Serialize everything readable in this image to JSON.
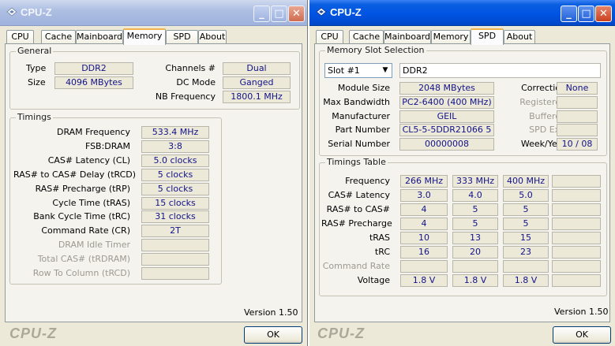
{
  "win1": {
    "title": "CPU-Z",
    "tabs": [
      "CPU",
      "Cache",
      "Mainboard",
      "Memory",
      "SPD",
      "About"
    ],
    "active_tab": "Memory",
    "general": {
      "title": "General",
      "type_label": "Type",
      "type_value": "DDR2",
      "size_label": "Size",
      "size_value": "4096 MBytes",
      "channels_label": "Channels #",
      "channels_value": "Dual",
      "dcmode_label": "DC Mode",
      "dcmode_value": "Ganged",
      "nbfreq_label": "NB Frequency",
      "nbfreq_value": "1800.1 MHz"
    },
    "timings": {
      "title": "Timings",
      "rows": [
        {
          "label": "DRAM Frequency",
          "value": "533.4 MHz",
          "disabled": false
        },
        {
          "label": "FSB:DRAM",
          "value": "3:8",
          "disabled": false
        },
        {
          "label": "CAS# Latency (CL)",
          "value": "5.0 clocks",
          "disabled": false
        },
        {
          "label": "RAS# to CAS# Delay (tRCD)",
          "value": "5 clocks",
          "disabled": false
        },
        {
          "label": "RAS# Precharge (tRP)",
          "value": "5 clocks",
          "disabled": false
        },
        {
          "label": "Cycle Time (tRAS)",
          "value": "15 clocks",
          "disabled": false
        },
        {
          "label": "Bank Cycle Time (tRC)",
          "value": "31 clocks",
          "disabled": false
        },
        {
          "label": "Command Rate (CR)",
          "value": "2T",
          "disabled": false
        },
        {
          "label": "DRAM Idle Timer",
          "value": "",
          "disabled": true
        },
        {
          "label": "Total CAS# (tRDRAM)",
          "value": "",
          "disabled": true
        },
        {
          "label": "Row To Column (tRCD)",
          "value": "",
          "disabled": true
        }
      ]
    },
    "version": "Version 1.50",
    "brand": "CPU-Z",
    "ok": "OK"
  },
  "win2": {
    "title": "CPU-Z",
    "tabs": [
      "CPU",
      "Cache",
      "Mainboard",
      "Memory",
      "SPD",
      "About"
    ],
    "active_tab": "SPD",
    "slot": {
      "title": "Memory Slot Selection",
      "selected": "Slot #1",
      "type": "DDR2",
      "rows_left": [
        {
          "label": "Module Size",
          "value": "2048 MBytes"
        },
        {
          "label": "Max Bandwidth",
          "value": "PC2-6400 (400 MHz)"
        },
        {
          "label": "Manufacturer",
          "value": "GEIL"
        },
        {
          "label": "Part Number",
          "value": "CL5-5-5DDR21066 5"
        },
        {
          "label": "Serial Number",
          "value": "00000008"
        }
      ],
      "rows_right": [
        {
          "label": "Correction",
          "value": "None",
          "disabled": false
        },
        {
          "label": "Registered",
          "value": "",
          "disabled": true
        },
        {
          "label": "Buffered",
          "value": "",
          "disabled": true
        },
        {
          "label": "SPD Ext.",
          "value": "",
          "disabled": true
        },
        {
          "label": "Week/Year",
          "value": "10 / 08",
          "disabled": false
        }
      ]
    },
    "table": {
      "title": "Timings Table",
      "rows": [
        {
          "label": "Frequency",
          "values": [
            "266 MHz",
            "333 MHz",
            "400 MHz",
            ""
          ],
          "disabled": false
        },
        {
          "label": "CAS# Latency",
          "values": [
            "3.0",
            "4.0",
            "5.0",
            ""
          ],
          "disabled": false
        },
        {
          "label": "RAS# to CAS#",
          "values": [
            "4",
            "5",
            "5",
            ""
          ],
          "disabled": false
        },
        {
          "label": "RAS# Precharge",
          "values": [
            "4",
            "5",
            "5",
            ""
          ],
          "disabled": false
        },
        {
          "label": "tRAS",
          "values": [
            "10",
            "13",
            "15",
            ""
          ],
          "disabled": false
        },
        {
          "label": "tRC",
          "values": [
            "16",
            "20",
            "23",
            ""
          ],
          "disabled": false
        },
        {
          "label": "Command Rate",
          "values": [
            "",
            "",
            "",
            ""
          ],
          "disabled": true
        },
        {
          "label": "Voltage",
          "values": [
            "1.8 V",
            "1.8 V",
            "1.8 V",
            ""
          ],
          "disabled": false
        }
      ]
    },
    "version": "Version 1.50",
    "brand": "CPU-Z",
    "ok": "OK"
  },
  "colors": {
    "titlebar_active": "#0054e3",
    "titlebar_inactive": "#9fb2dc",
    "value_text": "#12128a",
    "tab_highlight": "#f1b34b"
  }
}
